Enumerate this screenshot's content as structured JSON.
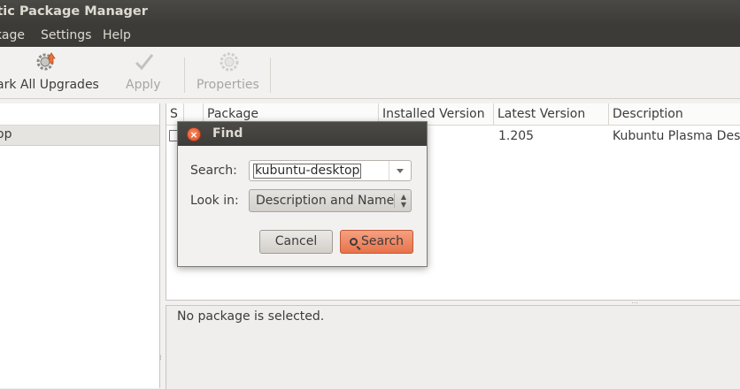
{
  "window": {
    "title": "ptic Package Manager"
  },
  "menu": {
    "items": [
      "kage",
      "Settings",
      "Help"
    ]
  },
  "toolbar": {
    "mark_all_upgrades": "ark All Upgrades",
    "apply": "Apply",
    "properties": "Properties"
  },
  "sidebar": {
    "selected_item": "op"
  },
  "package_table": {
    "columns": [
      "S",
      "",
      "Package",
      "Installed Version",
      "Latest Version",
      "Description"
    ],
    "rows": [
      {
        "status": "",
        "package": "",
        "installed_version": "",
        "latest_version": "1.205",
        "description": "Kubuntu Plasma Desk"
      }
    ]
  },
  "details": {
    "text": "No package is selected."
  },
  "find_dialog": {
    "title": "Find",
    "search_label": "Search:",
    "search_value": "kubuntu-desktop",
    "look_in_label": "Look in:",
    "look_in_value": "Description and Name",
    "cancel_label": "Cancel",
    "search_button_label": "Search"
  },
  "colors": {
    "titlebar": "#3c3b37",
    "accent": "#e8734c",
    "close_button": "#df4a1b"
  }
}
